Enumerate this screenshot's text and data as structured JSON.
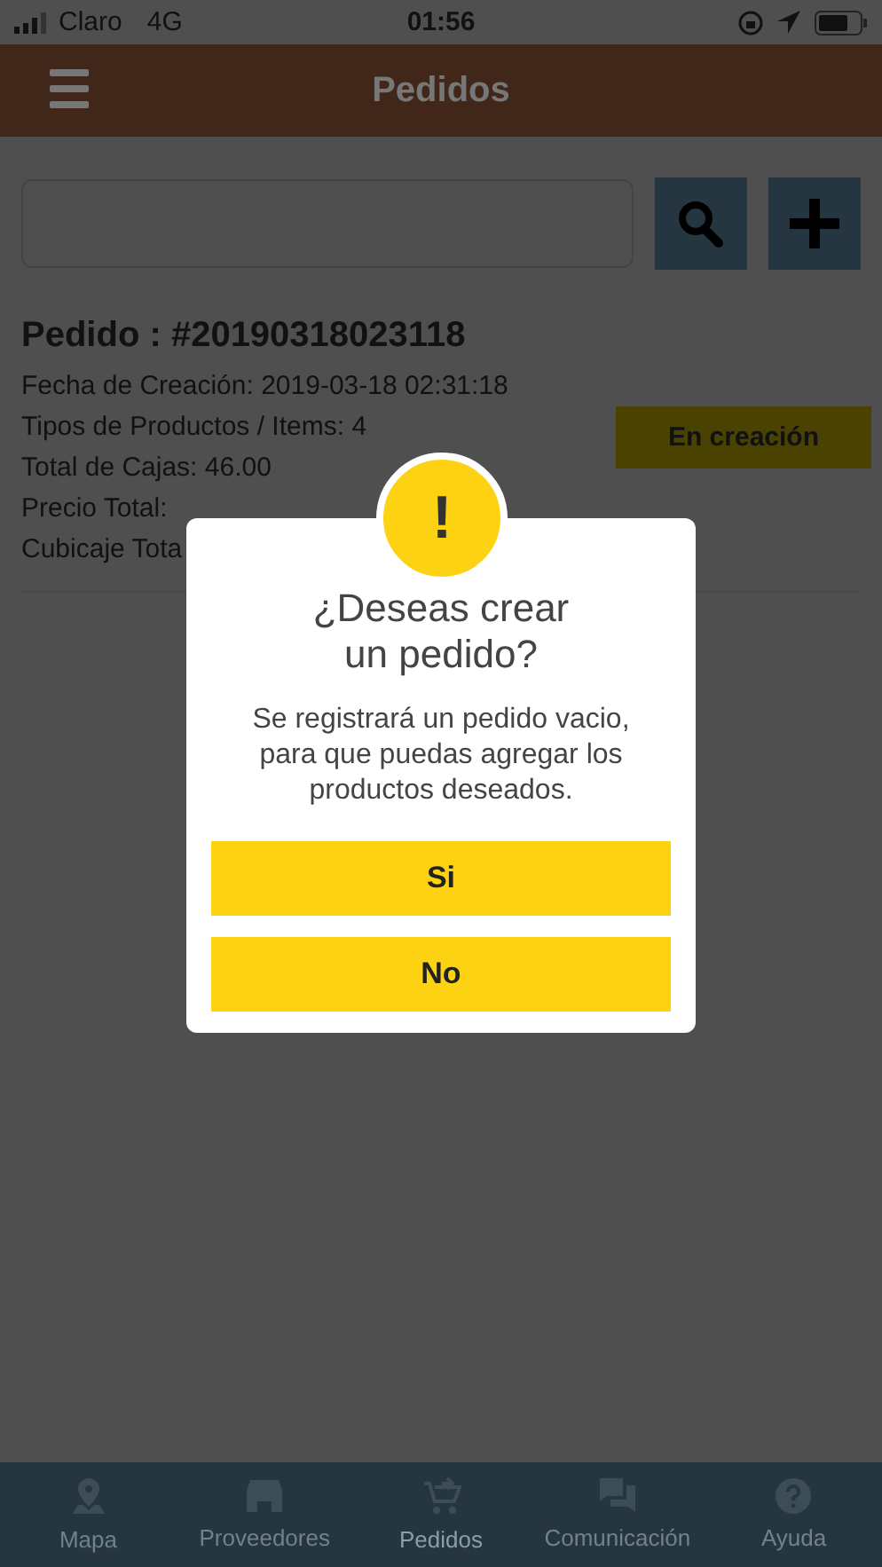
{
  "status_bar": {
    "carrier": "Claro",
    "network": "4G",
    "time": "01:56"
  },
  "header": {
    "title": "Pedidos"
  },
  "order": {
    "title": "Pedido : #20190318023118",
    "status": "En creación",
    "details": [
      "Fecha de Creación: 2019-03-18 02:31:18",
      "Tipos de Productos / Items: 4",
      "Total de Cajas: 46.00",
      "Precio Total:",
      "Cubicaje Tota"
    ]
  },
  "dialog": {
    "icon": "!",
    "title": "¿Deseas crear\nun pedido?",
    "message": "Se registrará un pedido vacio,\npara que puedas agregar los\nproductos deseados.",
    "buttons": [
      "Si",
      "No"
    ]
  },
  "tab_bar": [
    {
      "kind": "map",
      "label": "Mapa",
      "selected": false
    },
    {
      "kind": "store",
      "label": "Proveedores",
      "selected": false
    },
    {
      "kind": "cart",
      "label": "Pedidos",
      "selected": true
    },
    {
      "kind": "chat",
      "label": "Comunicación",
      "selected": false
    },
    {
      "kind": "help",
      "label": "Ayuda",
      "selected": false
    }
  ]
}
